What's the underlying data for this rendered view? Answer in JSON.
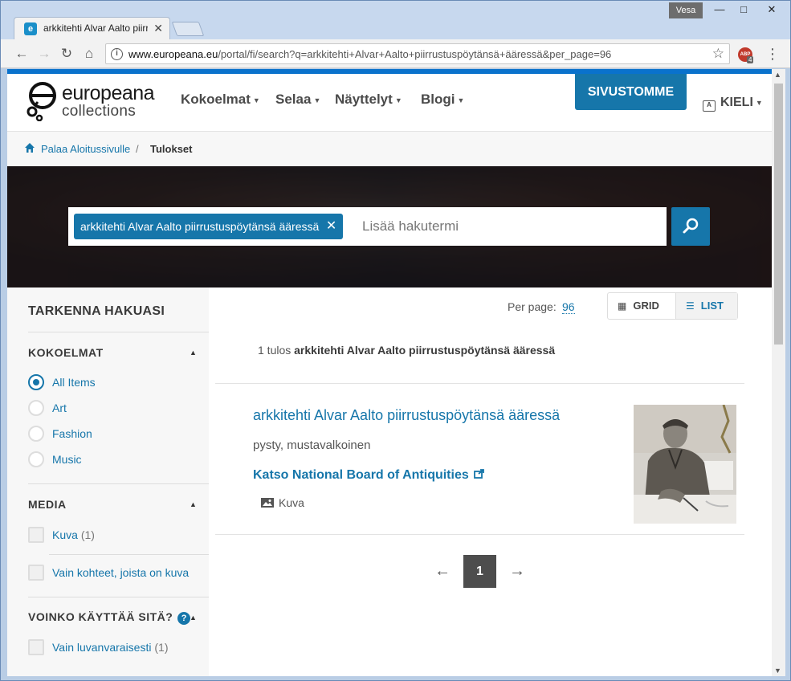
{
  "window": {
    "user": "Vesa",
    "tab_title": "arkkitehti Alvar Aalto piirr",
    "url_domain": "www.europeana.eu",
    "url_path": "/portal/fi/search?q=arkkitehti+Alvar+Aalto+piirrustuspöytänsä+ääressä&per_page=96",
    "abp_label": "ABP",
    "abp_count": "4"
  },
  "header": {
    "logo_top": "europeana",
    "logo_bottom": "collections",
    "nav": [
      "Kokoelmat",
      "Selaa",
      "Näyttelyt",
      "Blogi"
    ],
    "cta": "SIVUSTOMME",
    "language": "KIELI"
  },
  "breadcrumb": {
    "home": "Palaa Aloitussivulle",
    "separator": "/",
    "current": "Tulokset"
  },
  "search": {
    "active_term": "arkkitehti Alvar Aalto piirrustuspöytänsä ääressä",
    "placeholder": "Lisää hakutermi"
  },
  "sidebar": {
    "title": "TARKENNA HAKUASI",
    "collections": {
      "heading": "KOKOELMAT",
      "options": [
        "All Items",
        "Art",
        "Fashion",
        "Music"
      ],
      "selected": "All Items"
    },
    "media": {
      "heading": "MEDIA",
      "items": [
        {
          "label": "Kuva",
          "count": "(1)"
        },
        {
          "label": "Vain kohteet, joista on kuva",
          "count": ""
        }
      ]
    },
    "rights": {
      "heading": "VOINKO KÄYTTÄÄ SITÄ?",
      "help": "?",
      "items": [
        {
          "label": "Vain luvanvaraisesti",
          "count": "(1)"
        }
      ]
    }
  },
  "results": {
    "per_page_label": "Per page:",
    "per_page_value": "96",
    "view_grid": "GRID",
    "view_list": "LIST",
    "count_prefix": "1 tulos",
    "count_query": "arkkitehti Alvar Aalto piirrustuspöytänsä ääressä",
    "items": [
      {
        "title": "arkkitehti Alvar Aalto piirrustuspöytänsä ääressä",
        "description": "pysty, mustavalkoinen",
        "provider": "Katso National Board of Antiquities",
        "type": "Kuva"
      }
    ],
    "pager": {
      "prev": "←",
      "current": "1",
      "next": "→"
    }
  },
  "colors": {
    "brand_blue": "#1676aa",
    "top_line": "#0a72cc"
  }
}
